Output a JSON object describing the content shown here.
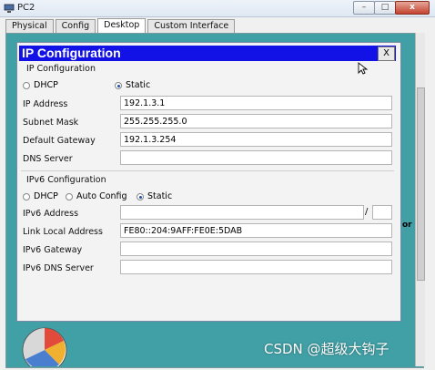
{
  "window": {
    "title": "PC2",
    "buttons": [
      "–",
      "□",
      "x"
    ]
  },
  "tabs": [
    {
      "label": "Physical",
      "active": false
    },
    {
      "label": "Config",
      "active": false
    },
    {
      "label": "Desktop",
      "active": true
    },
    {
      "label": "Custom Interface",
      "active": false
    }
  ],
  "ip_window": {
    "title": "IP Configuration",
    "close_label": "X",
    "ipv4": {
      "section_title": "IP Configuration",
      "modes": [
        {
          "label": "DHCP",
          "selected": false
        },
        {
          "label": "Static",
          "selected": true
        }
      ],
      "fields": {
        "ip_address": {
          "label": "IP Address",
          "value": "192.1.3.1"
        },
        "subnet_mask": {
          "label": "Subnet Mask",
          "value": "255.255.255.0"
        },
        "default_gateway": {
          "label": "Default Gateway",
          "value": "192.1.3.254"
        },
        "dns_server": {
          "label": "DNS Server",
          "value": ""
        }
      }
    },
    "ipv6": {
      "section_title": "IPv6 Configuration",
      "modes": [
        {
          "label": "DHCP",
          "selected": false
        },
        {
          "label": "Auto Config",
          "selected": false
        },
        {
          "label": "Static",
          "selected": true
        }
      ],
      "fields": {
        "ipv6_address": {
          "label": "IPv6 Address",
          "value": "",
          "prefix": ""
        },
        "link_local": {
          "label": "Link Local Address",
          "value": "FE80::204:9AFF:FE0E:5DAB"
        },
        "ipv6_gateway": {
          "label": "IPv6 Gateway",
          "value": ""
        },
        "ipv6_dns": {
          "label": "IPv6 DNS Server",
          "value": ""
        }
      },
      "prefix_separator": "/"
    }
  },
  "side_text": "or",
  "watermark": "CSDN @超级大钩子",
  "colors": {
    "desktop": "#40a0a6",
    "title_bar": "#1212e6",
    "window_bg": "#f3f3f3"
  }
}
